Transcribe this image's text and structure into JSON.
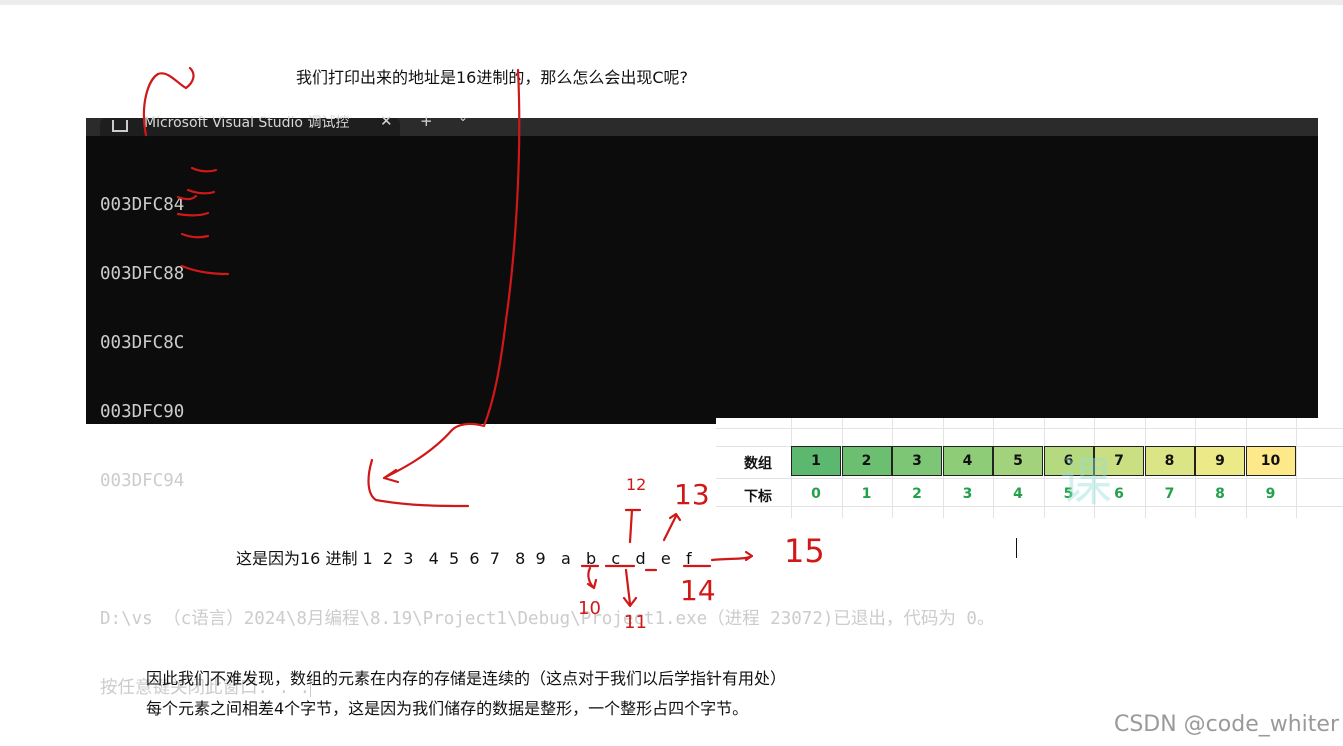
{
  "note_top": "我们打印出来的地址是16进制的，那么怎么会出现C呢?",
  "console": {
    "tab_title": "Microsoft Visual Studio 调试控",
    "tab_close": "✕",
    "tab_add": "+",
    "tab_menu": "⌄",
    "lines": [
      "003DFC84",
      "003DFC88",
      "003DFC8C",
      "003DFC90",
      "003DFC94",
      "",
      "D:\\vs （c语言）2024\\8月编程\\8.19\\Project1\\Debug\\Project1.exe（进程 23072)已退出，代码为 0。",
      "按任意键关闭此窗口. . ."
    ]
  },
  "sheet": {
    "row1_label": "数组",
    "row2_label": "下标",
    "values": [
      "1",
      "2",
      "3",
      "4",
      "5",
      "6",
      "7",
      "8",
      "9",
      "10"
    ],
    "indices": [
      "0",
      "1",
      "2",
      "3",
      "4",
      "5",
      "6",
      "7",
      "8",
      "9"
    ],
    "colors": [
      "#5cb86e",
      "#6cbf71",
      "#7dc675",
      "#8fcc78",
      "#a2d27b",
      "#b5d97e",
      "#c9df82",
      "#dbe585",
      "#ecea88",
      "#fde88a"
    ],
    "index_color": "#22a04a"
  },
  "mid_text": "这是因为16 进制 1  2  3   4  5  6  7   8  9   a   b   c   d   e   f",
  "handwritten": {
    "n10": "10",
    "n11": "11",
    "n12": "12",
    "n13": "13",
    "n14": "14",
    "n15": "15"
  },
  "bottom_line1": "因此我们不难发现，数组的元素在内存的存储是连续的（这点对于我们以后学指针有用处）",
  "bottom_line2": "每个元素之间相差4个字节，这是因为我们储存的数据是整形，一个整形占四个字节。",
  "csdn": "CSDN @code_whiter",
  "ink_color": "#d01818"
}
